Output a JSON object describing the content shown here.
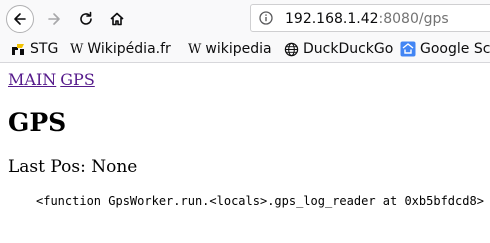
{
  "browser": {
    "url_host": "192.168.1.42",
    "url_rest": ":8080/gps",
    "bookmarks": [
      {
        "label": "STG",
        "icon": "stg-bookmark-icon"
      },
      {
        "label": "Wikipédia.fr",
        "icon": "wikipedia-w-icon"
      },
      {
        "label": "wikipedia",
        "icon": "wikipedia-w-icon"
      },
      {
        "label": "DuckDuckGo",
        "icon": "globe-icon"
      },
      {
        "label": "Google Sch",
        "icon": "google-scholar-icon"
      }
    ]
  },
  "page": {
    "nav_links": [
      "MAIN",
      "GPS"
    ],
    "title": "GPS",
    "last_pos": "Last Pos: None",
    "function_repr": "<function GpsWorker.run.<locals>.gps_log_reader at 0xb5bfdcd8>"
  }
}
